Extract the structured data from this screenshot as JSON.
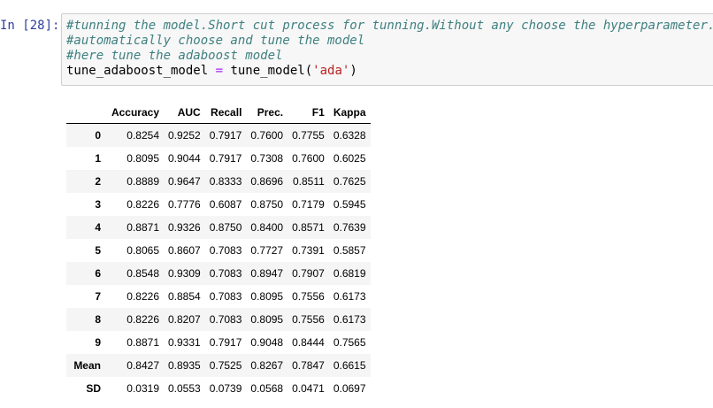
{
  "cell": {
    "prompt": "In [28]:",
    "code_lines": [
      [
        {
          "cls": "cm-comment",
          "text": "#tunning the model.Short cut process for tunning.Without any choose the hyperparameter."
        }
      ],
      [
        {
          "cls": "cm-comment",
          "text": "#automatically choose and tune the model"
        }
      ],
      [
        {
          "cls": "cm-comment",
          "text": "#here tune the adaboost model"
        }
      ],
      [
        {
          "cls": "cm-var",
          "text": "tune_adaboost_model "
        },
        {
          "cls": "cm-op",
          "text": "="
        },
        {
          "cls": "cm-var",
          "text": " tune_model"
        },
        {
          "cls": "cm-punct",
          "text": "("
        },
        {
          "cls": "cm-str",
          "text": "'ada'"
        },
        {
          "cls": "cm-punct",
          "text": ")"
        }
      ]
    ]
  },
  "output_table": {
    "columns": [
      "",
      "Accuracy",
      "AUC",
      "Recall",
      "Prec.",
      "F1",
      "Kappa"
    ],
    "rows": [
      {
        "index": "0",
        "values": [
          "0.8254",
          "0.9252",
          "0.7917",
          "0.7600",
          "0.7755",
          "0.6328"
        ]
      },
      {
        "index": "1",
        "values": [
          "0.8095",
          "0.9044",
          "0.7917",
          "0.7308",
          "0.7600",
          "0.6025"
        ]
      },
      {
        "index": "2",
        "values": [
          "0.8889",
          "0.9647",
          "0.8333",
          "0.8696",
          "0.8511",
          "0.7625"
        ]
      },
      {
        "index": "3",
        "values": [
          "0.8226",
          "0.7776",
          "0.6087",
          "0.8750",
          "0.7179",
          "0.5945"
        ]
      },
      {
        "index": "4",
        "values": [
          "0.8871",
          "0.9326",
          "0.8750",
          "0.8400",
          "0.8571",
          "0.7639"
        ]
      },
      {
        "index": "5",
        "values": [
          "0.8065",
          "0.8607",
          "0.7083",
          "0.7727",
          "0.7391",
          "0.5857"
        ]
      },
      {
        "index": "6",
        "values": [
          "0.8548",
          "0.9309",
          "0.7083",
          "0.8947",
          "0.7907",
          "0.6819"
        ]
      },
      {
        "index": "7",
        "values": [
          "0.8226",
          "0.8854",
          "0.7083",
          "0.8095",
          "0.7556",
          "0.6173"
        ]
      },
      {
        "index": "8",
        "values": [
          "0.8226",
          "0.8207",
          "0.7083",
          "0.8095",
          "0.7556",
          "0.6173"
        ]
      },
      {
        "index": "9",
        "values": [
          "0.8871",
          "0.9331",
          "0.7917",
          "0.9048",
          "0.8444",
          "0.7565"
        ]
      },
      {
        "index": "Mean",
        "values": [
          "0.8427",
          "0.8935",
          "0.7525",
          "0.8267",
          "0.7847",
          "0.6615"
        ]
      },
      {
        "index": "SD",
        "values": [
          "0.0319",
          "0.0553",
          "0.0739",
          "0.0568",
          "0.0471",
          "0.0697"
        ]
      }
    ]
  }
}
